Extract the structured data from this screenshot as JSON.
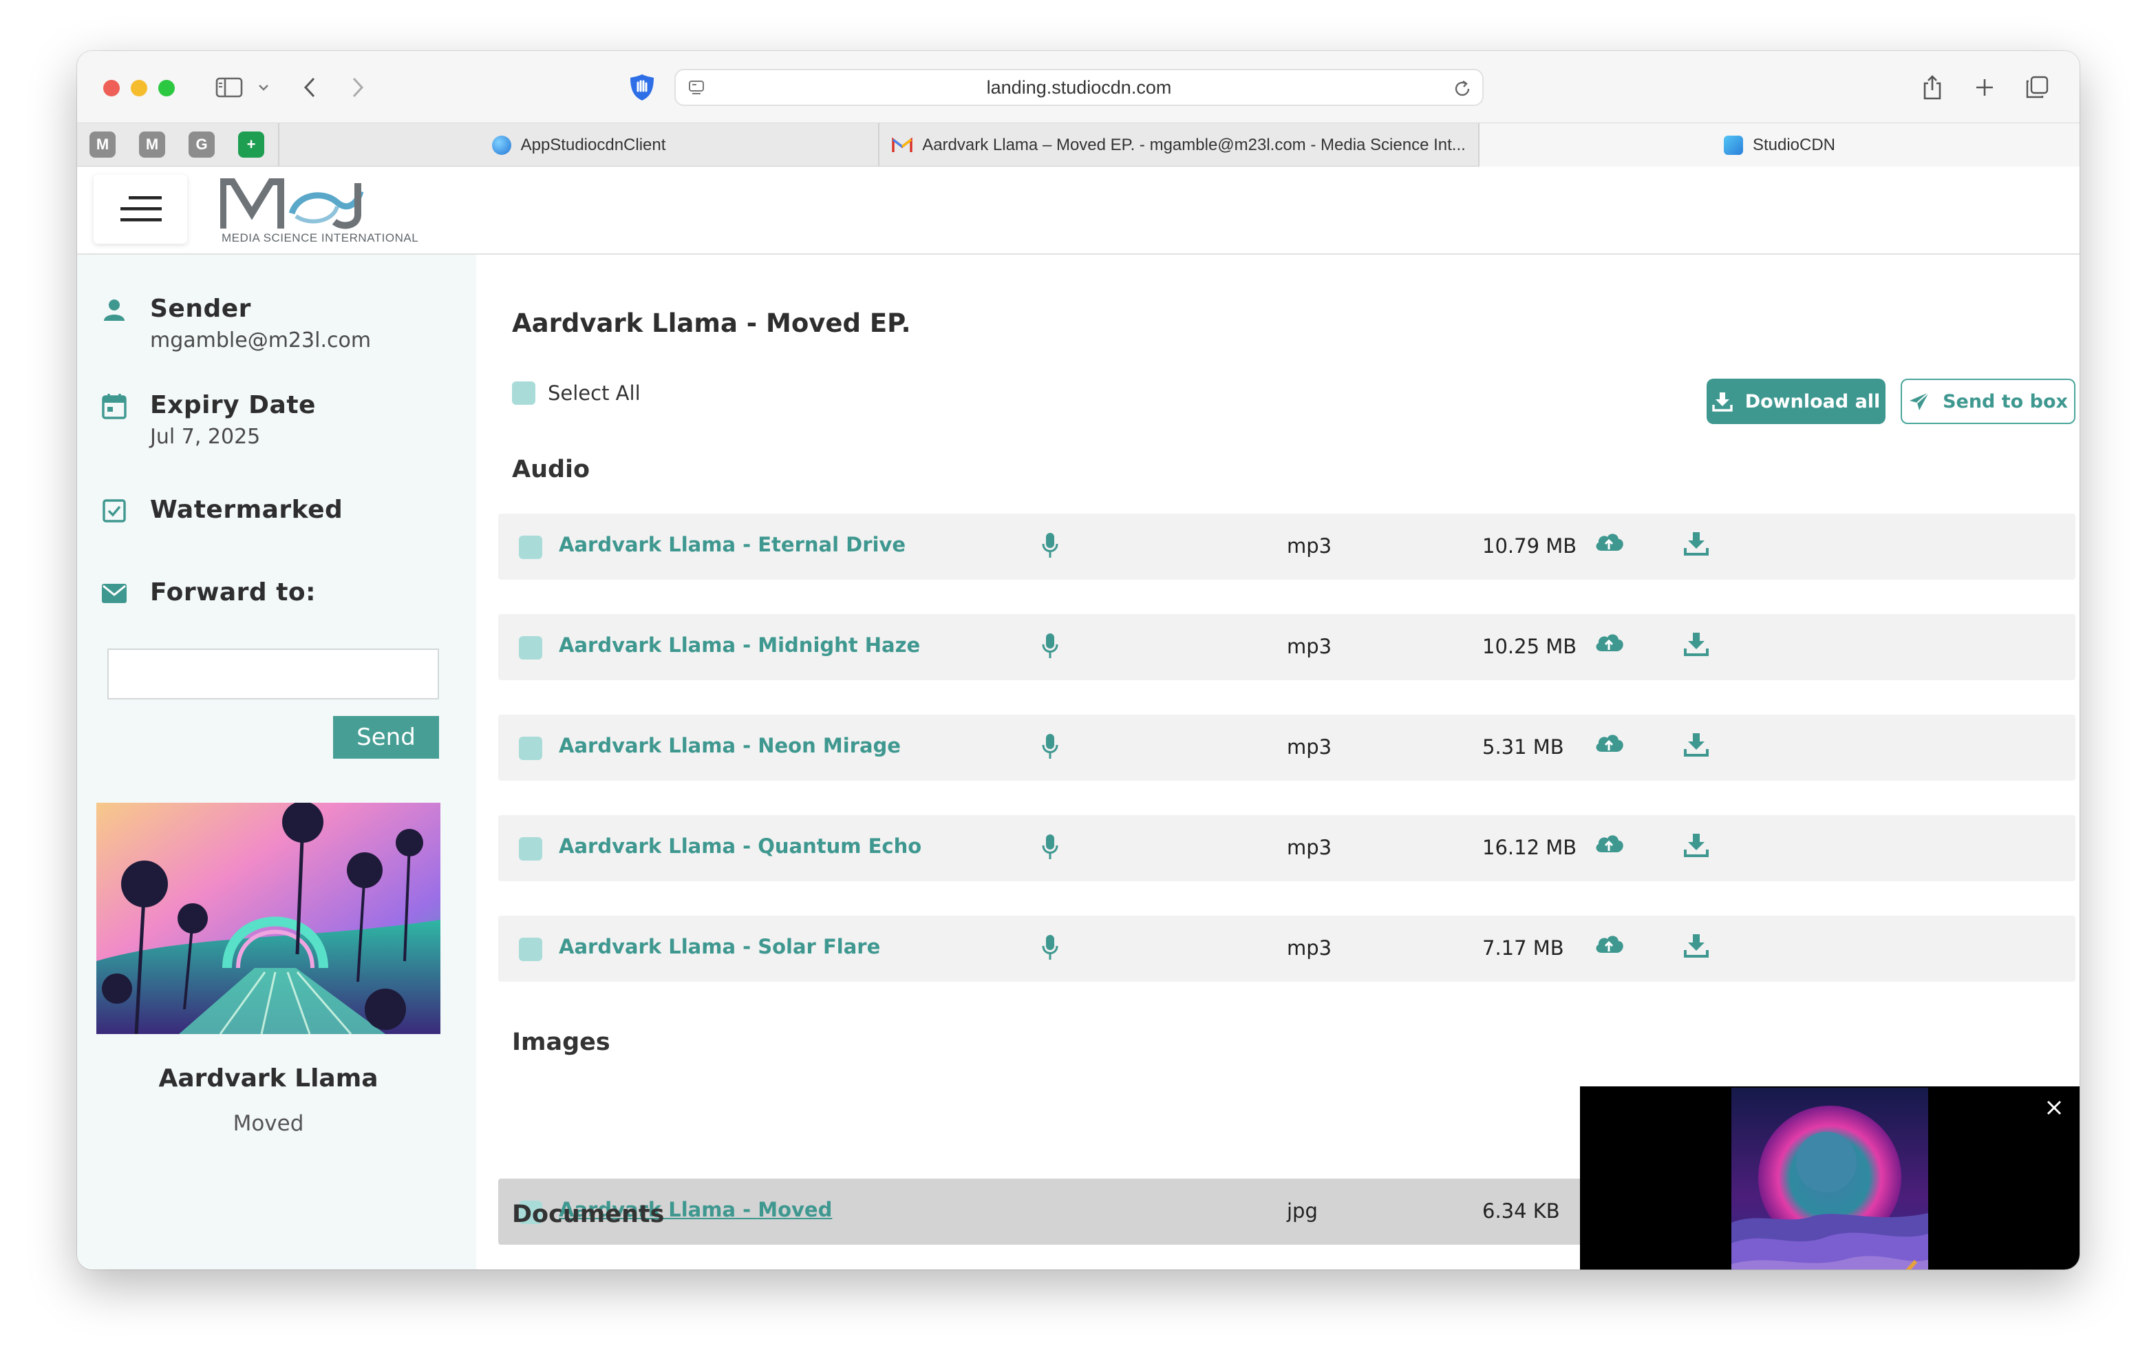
{
  "browser": {
    "url": "landing.studiocdn.com",
    "pinned_tabs": [
      "M",
      "M",
      "G",
      "+"
    ],
    "tabs": [
      {
        "title": "AppStudiocdnClient"
      },
      {
        "title": "Aardvark Llama – Moved EP. - mgamble@m23l.com - Media Science Int..."
      },
      {
        "title": "StudioCDN"
      }
    ]
  },
  "header": {
    "logo_letters": "MSI",
    "logo_text": "MEDIA SCIENCE INTERNATIONAL"
  },
  "sidebar": {
    "sender_label": "Sender",
    "sender_value": "mgamble@m23l.com",
    "expiry_label": "Expiry Date",
    "expiry_value": "Jul 7, 2025",
    "watermarked_label": "Watermarked",
    "forward_label": "Forward to:",
    "forward_value": "",
    "send_label": "Send",
    "artist": "Aardvark Llama",
    "album": "Moved"
  },
  "main": {
    "title": "Aardvark Llama - Moved EP.",
    "select_all_label": "Select All",
    "download_all_label": "Download all",
    "send_to_box_label": "Send to box",
    "sections": {
      "audio": "Audio",
      "images": "Images",
      "documents": "Documents"
    },
    "audio_files": [
      {
        "name": "Aardvark Llama - Eternal Drive",
        "type": "mp3",
        "size": "10.79 MB"
      },
      {
        "name": "Aardvark Llama - Midnight Haze",
        "type": "mp3",
        "size": "10.25 MB"
      },
      {
        "name": "Aardvark Llama - Neon Mirage",
        "type": "mp3",
        "size": "5.31 MB"
      },
      {
        "name": "Aardvark Llama - Quantum Echo",
        "type": "mp3",
        "size": "16.12 MB"
      },
      {
        "name": "Aardvark Llama - Solar Flare",
        "type": "mp3",
        "size": "7.17 MB"
      }
    ],
    "image_files": [
      {
        "name": "Aardvark Llama - Moved",
        "type": "jpg",
        "size": "6.34 KB"
      }
    ]
  },
  "colors": {
    "accent": "#3f9890",
    "checkbox": "#a9dcd8",
    "row_bg": "#f2f2f2",
    "row_hover": "#d3d3d3",
    "sidebar_bg": "#f3f8f8"
  },
  "icons": {
    "sender": "person-icon",
    "expiry": "calendar-icon",
    "watermarked": "checkbox-icon",
    "forward": "envelope-icon",
    "audio_type": "microphone-icon",
    "upload": "cloud-upload-icon",
    "download": "download-icon",
    "send": "paper-plane-icon",
    "close": "close-icon"
  }
}
